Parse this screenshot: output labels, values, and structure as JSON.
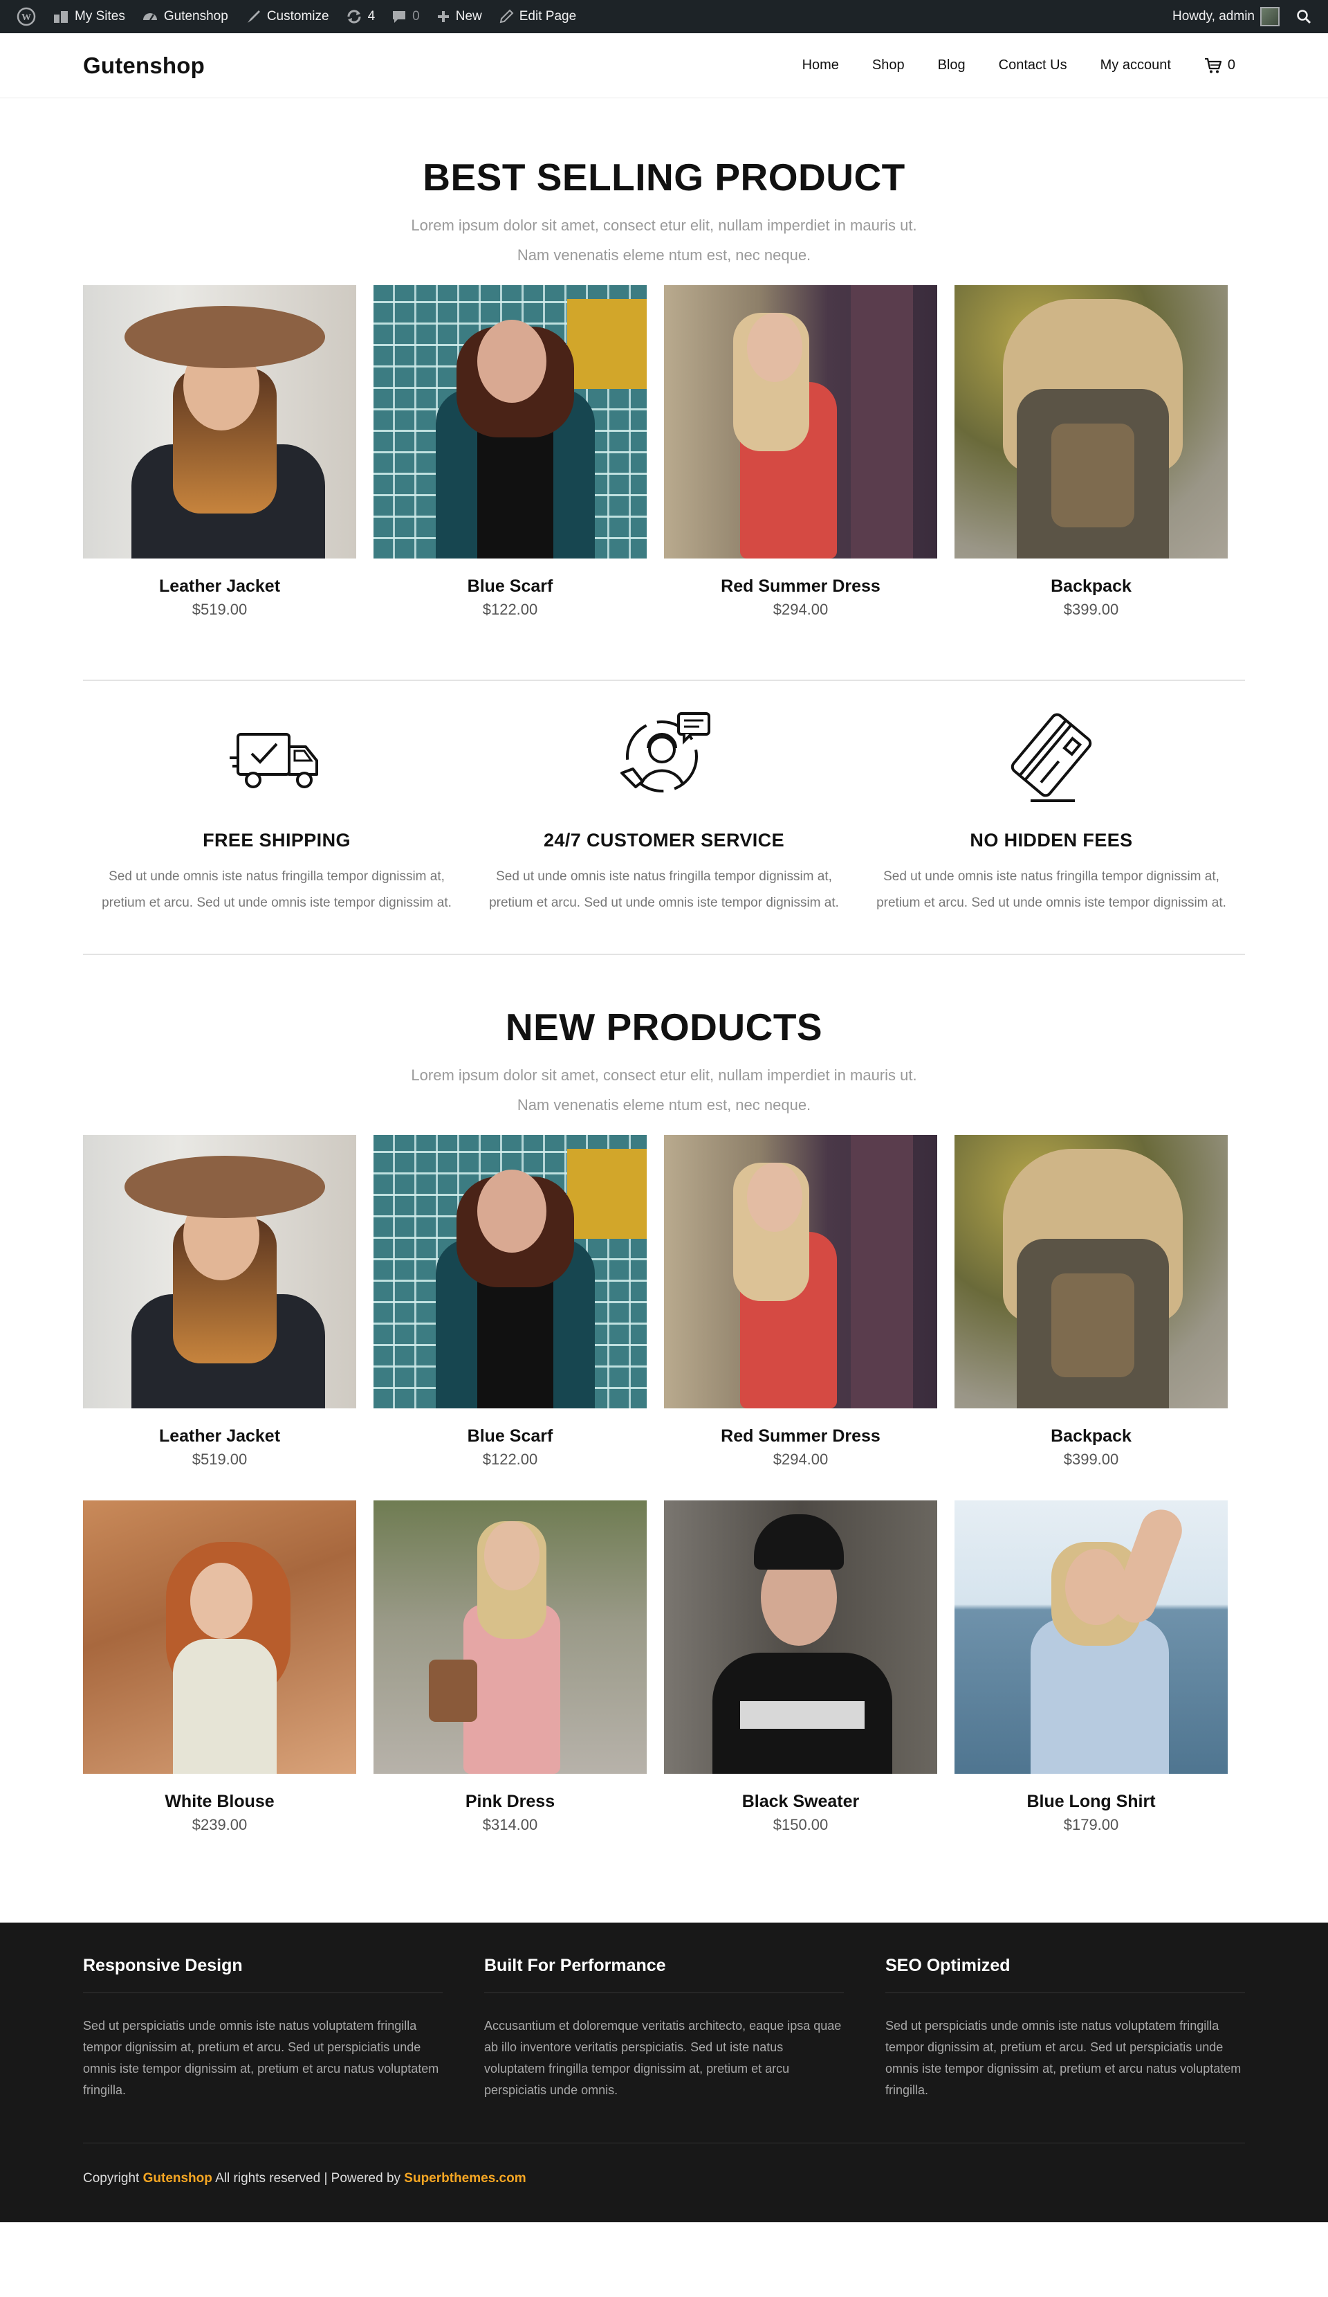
{
  "adminbar": {
    "my_sites": "My Sites",
    "site": "Gutenshop",
    "customize": "Customize",
    "updates": "4",
    "comments": "0",
    "new": "New",
    "edit_page": "Edit Page",
    "howdy": "Howdy, admin"
  },
  "header": {
    "logo": "Gutenshop",
    "nav": [
      "Home",
      "Shop",
      "Blog",
      "Contact Us",
      "My account"
    ],
    "cart_count": "0"
  },
  "best_selling": {
    "title": "BEST SELLING PRODUCT",
    "subtitle_line1": "Lorem ipsum dolor sit amet, consect etur elit, nullam imperdiet in mauris ut.",
    "subtitle_line2": "Nam venenatis eleme ntum est, nec neque.",
    "products": [
      {
        "name": "Leather Jacket",
        "price": "$519.00"
      },
      {
        "name": "Blue Scarf",
        "price": "$122.00"
      },
      {
        "name": "Red Summer Dress",
        "price": "$294.00"
      },
      {
        "name": "Backpack",
        "price": "$399.00"
      }
    ]
  },
  "features": [
    {
      "icon": "delivery-truck-icon",
      "title": "FREE SHIPPING",
      "text": "Sed ut unde omnis iste natus fringilla tempor dignissim at, pretium et arcu. Sed ut unde omnis iste tempor dignissim at."
    },
    {
      "icon": "customer-service-icon",
      "title": "24/7 CUSTOMER SERVICE",
      "text": "Sed ut unde omnis iste natus fringilla tempor dignissim at, pretium et arcu. Sed ut unde omnis iste tempor dignissim at."
    },
    {
      "icon": "credit-card-icon",
      "title": "NO HIDDEN FEES",
      "text": "Sed ut unde omnis iste natus fringilla tempor dignissim at, pretium et arcu. Sed ut unde omnis iste tempor dignissim at."
    }
  ],
  "new_products": {
    "title": "NEW PRODUCTS",
    "subtitle_line1": "Lorem ipsum dolor sit amet, consect etur elit, nullam imperdiet in mauris ut.",
    "subtitle_line2": "Nam venenatis eleme ntum est, nec neque.",
    "products": [
      {
        "name": "Leather Jacket",
        "price": "$519.00"
      },
      {
        "name": "Blue Scarf",
        "price": "$122.00"
      },
      {
        "name": "Red Summer Dress",
        "price": "$294.00"
      },
      {
        "name": "Backpack",
        "price": "$399.00"
      },
      {
        "name": "White Blouse",
        "price": "$239.00"
      },
      {
        "name": "Pink Dress",
        "price": "$314.00"
      },
      {
        "name": "Black Sweater",
        "price": "$150.00"
      },
      {
        "name": "Blue Long Shirt",
        "price": "$179.00"
      }
    ]
  },
  "footer": {
    "columns": [
      {
        "title": "Responsive Design",
        "text": "Sed ut perspiciatis unde omnis iste natus voluptatem fringilla tempor dignissim at, pretium et arcu. Sed ut perspiciatis unde omnis iste tempor dignissim at, pretium et arcu natus voluptatem fringilla."
      },
      {
        "title": "Built For Performance",
        "text": "Accusantium et doloremque veritatis architecto, eaque ipsa quae ab illo inventore veritatis perspiciatis. Sed ut iste natus voluptatem fringilla tempor dignissim at, pretium et arcu perspiciatis unde omnis."
      },
      {
        "title": "SEO Optimized",
        "text": "Sed ut perspiciatis unde omnis iste natus voluptatem fringilla tempor dignissim at, pretium et arcu. Sed ut perspiciatis unde omnis iste tempor dignissim at, pretium et arcu natus voluptatem fringilla."
      }
    ],
    "copyright_prefix": "Copyright",
    "copyright_site": "Gutenshop",
    "copyright_middle": "All rights reserved | Powered by",
    "copyright_link": "Superbthemes.com"
  },
  "colors": {
    "adminbar_bg": "#1d2327",
    "footer_bg": "#181818",
    "accent": "#f5a623"
  }
}
